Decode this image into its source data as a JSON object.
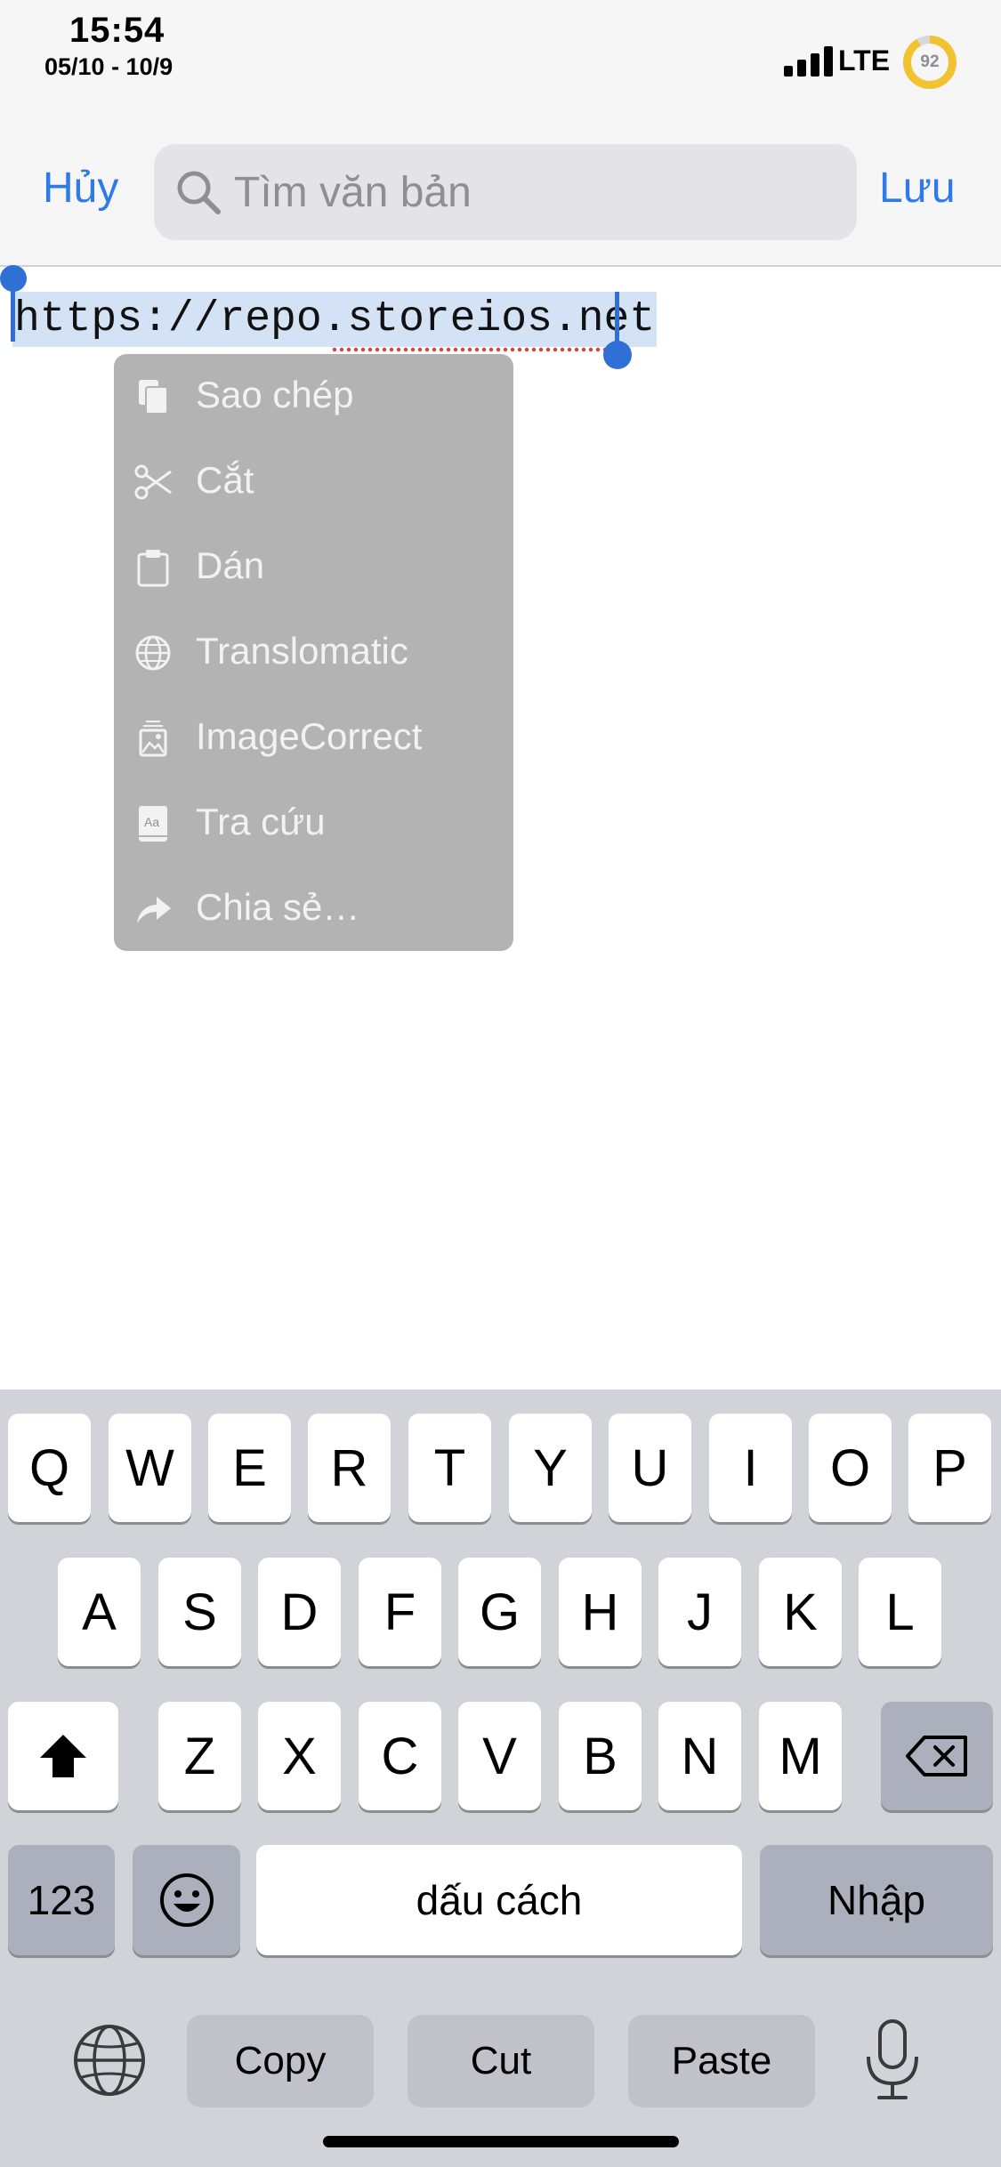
{
  "status_bar": {
    "time": "15:54",
    "date_range": "05/10 - 10/9",
    "network": "LTE",
    "battery": "92",
    "battery_fraction": 0.92,
    "battery_ring_color": "#f2c230"
  },
  "nav": {
    "cancel_label": "Hủy",
    "save_label": "Lưu",
    "search_placeholder": "Tìm văn bản",
    "accent_color": "#2f7be5"
  },
  "editor": {
    "text": "https://repo.storeios.net"
  },
  "context_menu": {
    "items": [
      {
        "label": "Sao chép",
        "icon": "copy-icon"
      },
      {
        "label": "Cắt",
        "icon": "scissors-icon"
      },
      {
        "label": "Dán",
        "icon": "clipboard-icon"
      },
      {
        "label": "Translomatic",
        "icon": "globe-icon"
      },
      {
        "label": "ImageCorrect",
        "icon": "image-icon"
      },
      {
        "label": "Tra cứu",
        "icon": "dictionary-icon"
      },
      {
        "label": "Chia sẻ…",
        "icon": "share-icon"
      }
    ]
  },
  "keyboard": {
    "row1": [
      "Q",
      "W",
      "E",
      "R",
      "T",
      "Y",
      "U",
      "I",
      "O",
      "P"
    ],
    "row2": [
      "A",
      "S",
      "D",
      "F",
      "G",
      "H",
      "J",
      "K",
      "L"
    ],
    "row3": [
      "Z",
      "X",
      "C",
      "V",
      "B",
      "N",
      "M"
    ],
    "numbers_label": "123",
    "space_label": "dấu cách",
    "return_label": "Nhập",
    "suggestions": [
      "Copy",
      "Cut",
      "Paste"
    ]
  }
}
